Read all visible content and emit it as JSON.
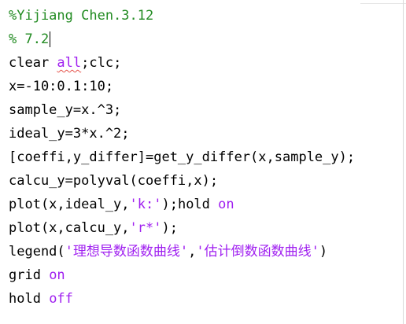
{
  "colors": {
    "background": "#ffffff",
    "comment": "#228b22",
    "keyword_string": "#a020f0",
    "code": "#000000",
    "squiggle": "#e5534b"
  },
  "editor": {
    "lines": [
      {
        "comment": "%Yijiang Chen.3.12"
      },
      {
        "comment": "% 7.2"
      },
      {
        "code_a": "clear ",
        "code_underlined": "all",
        "code_b": ";clc;"
      },
      {
        "code": "x=-10:0.1:10;"
      },
      {
        "code": "sample_y=x.^3;"
      },
      {
        "code": "ideal_y=3*x.^2;"
      },
      {
        "code": "[coeffi,y_differ]=get_y_differ(x,sample_y);"
      },
      {
        "code": "calcu_y=polyval(coeffi,x);"
      },
      {
        "code_a": "plot(x,ideal_y,",
        "string": "'k:'",
        "code_b": ");hold ",
        "keyword": "on"
      },
      {
        "code_a": "plot(x,calcu_y,",
        "string": "'r*'",
        "code_b": ");"
      },
      {
        "code_a": "legend(",
        "string_1": "'理想导数函数曲线'",
        "code_b": ",",
        "string_2": "'估计倒数函数曲线'",
        "code_c": ")"
      },
      {
        "code": "grid ",
        "keyword": "on"
      },
      {
        "code": "hold ",
        "keyword": "off"
      }
    ]
  }
}
